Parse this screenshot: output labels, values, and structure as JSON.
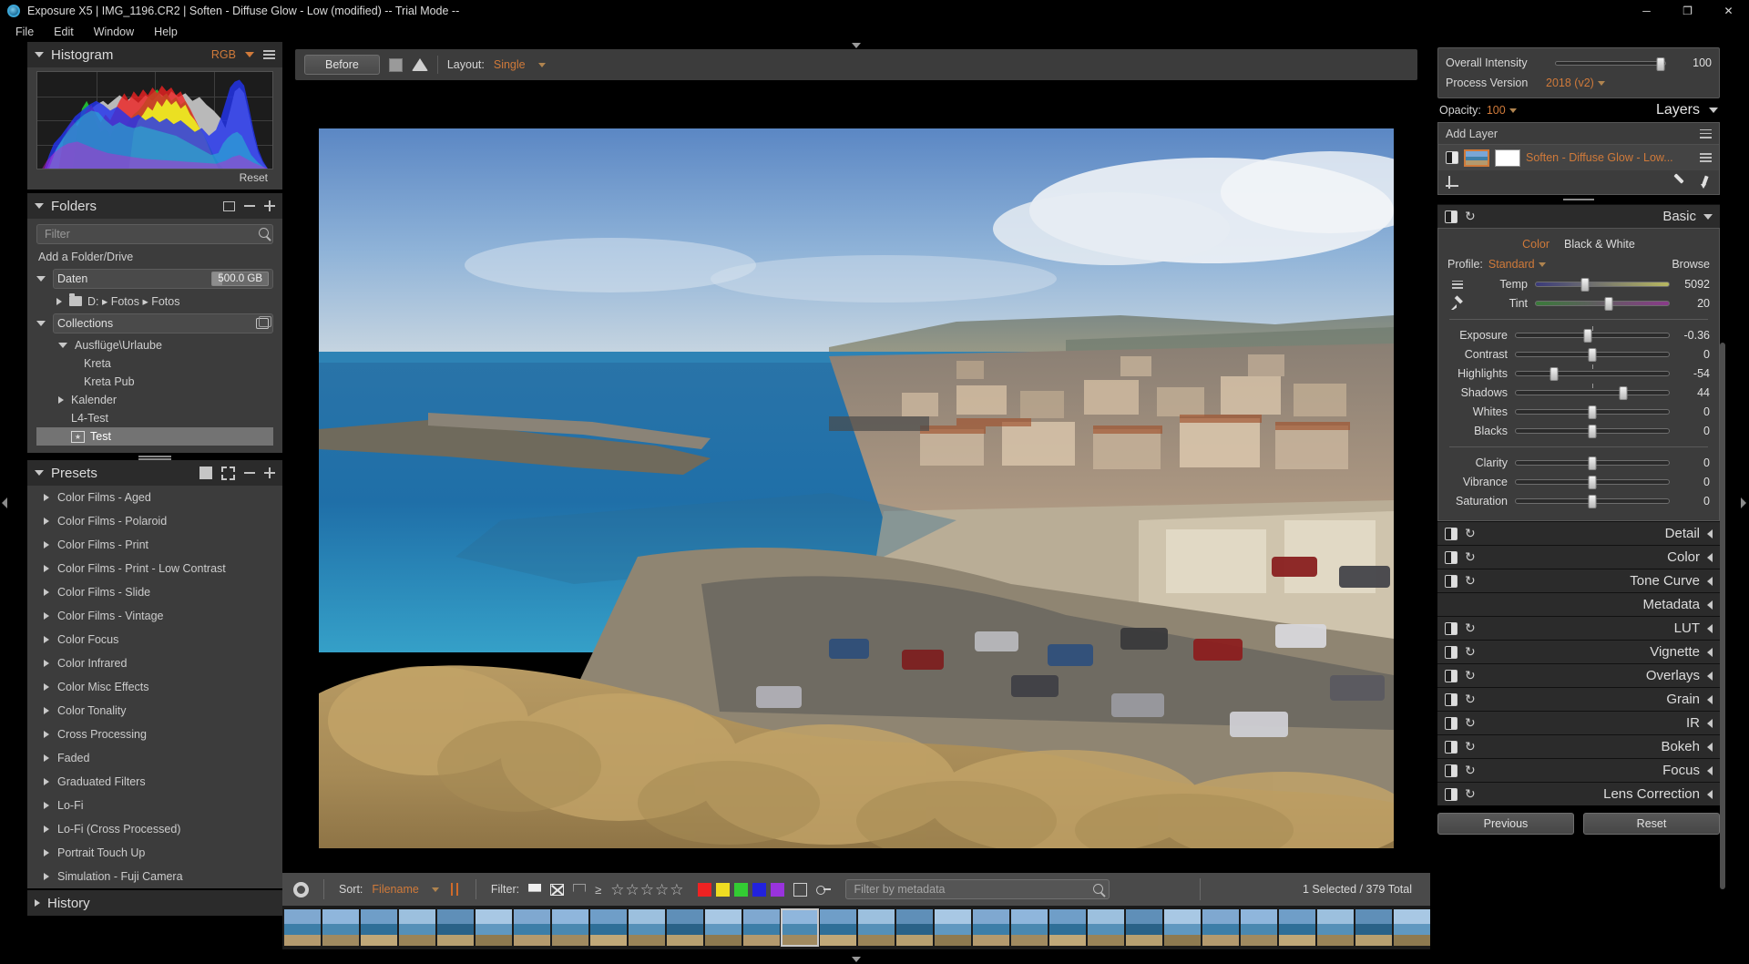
{
  "window": {
    "title": "Exposure X5 | IMG_1196.CR2 | Soften - Diffuse Glow - Low (modified) -- Trial Mode --",
    "minimize": "─",
    "maximize": "❐",
    "close": "✕"
  },
  "menu": [
    "File",
    "Edit",
    "Window",
    "Help"
  ],
  "histogram": {
    "title": "Histogram",
    "mode": "RGB",
    "reset": "Reset"
  },
  "folders": {
    "title": "Folders",
    "filter_placeholder": "Filter",
    "add_label": "Add a Folder/Drive",
    "drive": {
      "name": "Daten",
      "capacity": "500.0 GB"
    },
    "drive_child": "D: ▸ Fotos ▸ Fotos",
    "collections_label": "Collections",
    "items": [
      {
        "label": "Ausflüge\\Urlaube",
        "indent": 1,
        "expanded": true,
        "type": "group"
      },
      {
        "label": "Kreta",
        "indent": 2,
        "type": "leaf"
      },
      {
        "label": "Kreta Pub",
        "indent": 2,
        "type": "leaf"
      },
      {
        "label": "Kalender",
        "indent": 1,
        "expanded": false,
        "type": "group"
      },
      {
        "label": "L4-Test",
        "indent": 1,
        "type": "leaf"
      },
      {
        "label": "Test",
        "indent": 2,
        "type": "stack",
        "selected": true
      }
    ]
  },
  "presets": {
    "title": "Presets",
    "items": [
      "Color Films - Aged",
      "Color Films - Polaroid",
      "Color Films - Print",
      "Color Films - Print - Low Contrast",
      "Color Films - Slide",
      "Color Films - Vintage",
      "Color Focus",
      "Color Infrared",
      "Color Misc Effects",
      "Color Tonality",
      "Cross Processing",
      "Faded",
      "Graduated Filters",
      "Lo-Fi",
      "Lo-Fi (Cross Processed)",
      "Portrait Touch Up",
      "Simulation - Fuji Camera"
    ]
  },
  "history": {
    "title": "History"
  },
  "viewer": {
    "before_label": "Before",
    "layout_label": "Layout:",
    "layout_value": "Single"
  },
  "filmstrip": {
    "sort_label": "Sort:",
    "sort_value": "Filename",
    "filter_label": "Filter:",
    "rating_prefix": "≥",
    "stars": 5,
    "colors": [
      "#ee2222",
      "#eedd22",
      "#33cc33",
      "#2222dd",
      "#9933dd"
    ],
    "metadata_placeholder": "Filter by metadata",
    "count_text": "1 Selected / 379 Total",
    "thumb_count": 34,
    "selected_index": 13
  },
  "right": {
    "overall_intensity_label": "Overall Intensity",
    "overall_intensity_value": "100",
    "process_version_label": "Process Version",
    "process_version_value": "2018 (v2)",
    "opacity_label": "Opacity:",
    "opacity_value": "100",
    "layers_title": "Layers",
    "add_layer_label": "Add Layer",
    "layer_name": "Soften - Diffuse Glow - Low...",
    "basic": {
      "title": "Basic",
      "color_tab": "Color",
      "bw_tab": "Black & White",
      "profile_label": "Profile:",
      "profile_value": "Standard",
      "browse_label": "Browse",
      "sliders_group1": [
        {
          "name": "Temp",
          "value": "5092",
          "pos": 37,
          "gradient": "temp",
          "tick": null
        },
        {
          "name": "Tint",
          "value": "20",
          "pos": 55,
          "gradient": "tint",
          "tick": null
        }
      ],
      "sliders_group2": [
        {
          "name": "Exposure",
          "value": "-0.36",
          "pos": 47,
          "tick": 50
        },
        {
          "name": "Contrast",
          "value": "0",
          "pos": 50,
          "tick": null
        },
        {
          "name": "Highlights",
          "value": "-54",
          "pos": 25,
          "tick": 50
        },
        {
          "name": "Shadows",
          "value": "44",
          "pos": 70,
          "tick": 50
        },
        {
          "name": "Whites",
          "value": "0",
          "pos": 50,
          "tick": null
        },
        {
          "name": "Blacks",
          "value": "0",
          "pos": 50,
          "tick": null
        }
      ],
      "sliders_group3": [
        {
          "name": "Clarity",
          "value": "0",
          "pos": 50,
          "tick": null
        },
        {
          "name": "Vibrance",
          "value": "0",
          "pos": 50,
          "tick": null
        },
        {
          "name": "Saturation",
          "value": "0",
          "pos": 50,
          "tick": null
        }
      ]
    },
    "sections": [
      {
        "label": "Detail",
        "has_toggle": true
      },
      {
        "label": "Color",
        "has_toggle": true
      },
      {
        "label": "Tone Curve",
        "has_toggle": true
      },
      {
        "label": "Metadata",
        "has_toggle": false
      },
      {
        "label": "LUT",
        "has_toggle": true
      },
      {
        "label": "Vignette",
        "has_toggle": true
      },
      {
        "label": "Overlays",
        "has_toggle": true
      },
      {
        "label": "Grain",
        "has_toggle": true
      },
      {
        "label": "IR",
        "has_toggle": true
      },
      {
        "label": "Bokeh",
        "has_toggle": true
      },
      {
        "label": "Focus",
        "has_toggle": true
      },
      {
        "label": "Lens Correction",
        "has_toggle": true
      }
    ],
    "previous_label": "Previous",
    "reset_label": "Reset"
  }
}
